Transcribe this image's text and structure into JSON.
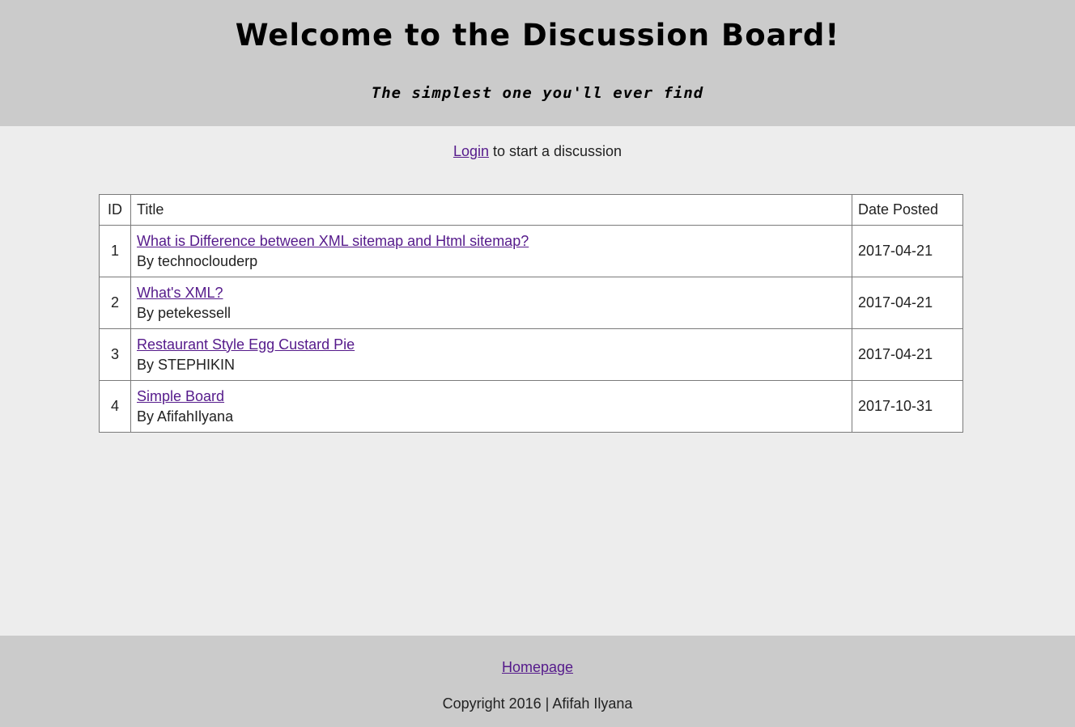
{
  "header": {
    "title": "Welcome to the Discussion Board!",
    "subtitle": "The simplest one you'll ever find"
  },
  "login_prompt": {
    "link_label": "Login",
    "text": " to start a discussion"
  },
  "table": {
    "columns": [
      "ID",
      "Title",
      "Date Posted"
    ],
    "rows": [
      {
        "id": "1",
        "title": "What is Difference between XML sitemap and Html sitemap?",
        "author": "By technoclouderp",
        "date": "2017-04-21"
      },
      {
        "id": "2",
        "title": "What's XML?",
        "author": "By petekessell",
        "date": "2017-04-21"
      },
      {
        "id": "3",
        "title": "Restaurant Style Egg Custard Pie",
        "author": "By STEPHIKIN",
        "date": "2017-04-21"
      },
      {
        "id": "4",
        "title": "Simple Board",
        "author": "By AfifahIlyana",
        "date": "2017-10-31"
      }
    ]
  },
  "footer": {
    "home_label": "Homepage",
    "copyright": "Copyright 2016 | Afifah Ilyana"
  },
  "colors": {
    "header_bg": "#cbcbcb",
    "page_bg": "#ededed",
    "link": "#551a8b"
  }
}
